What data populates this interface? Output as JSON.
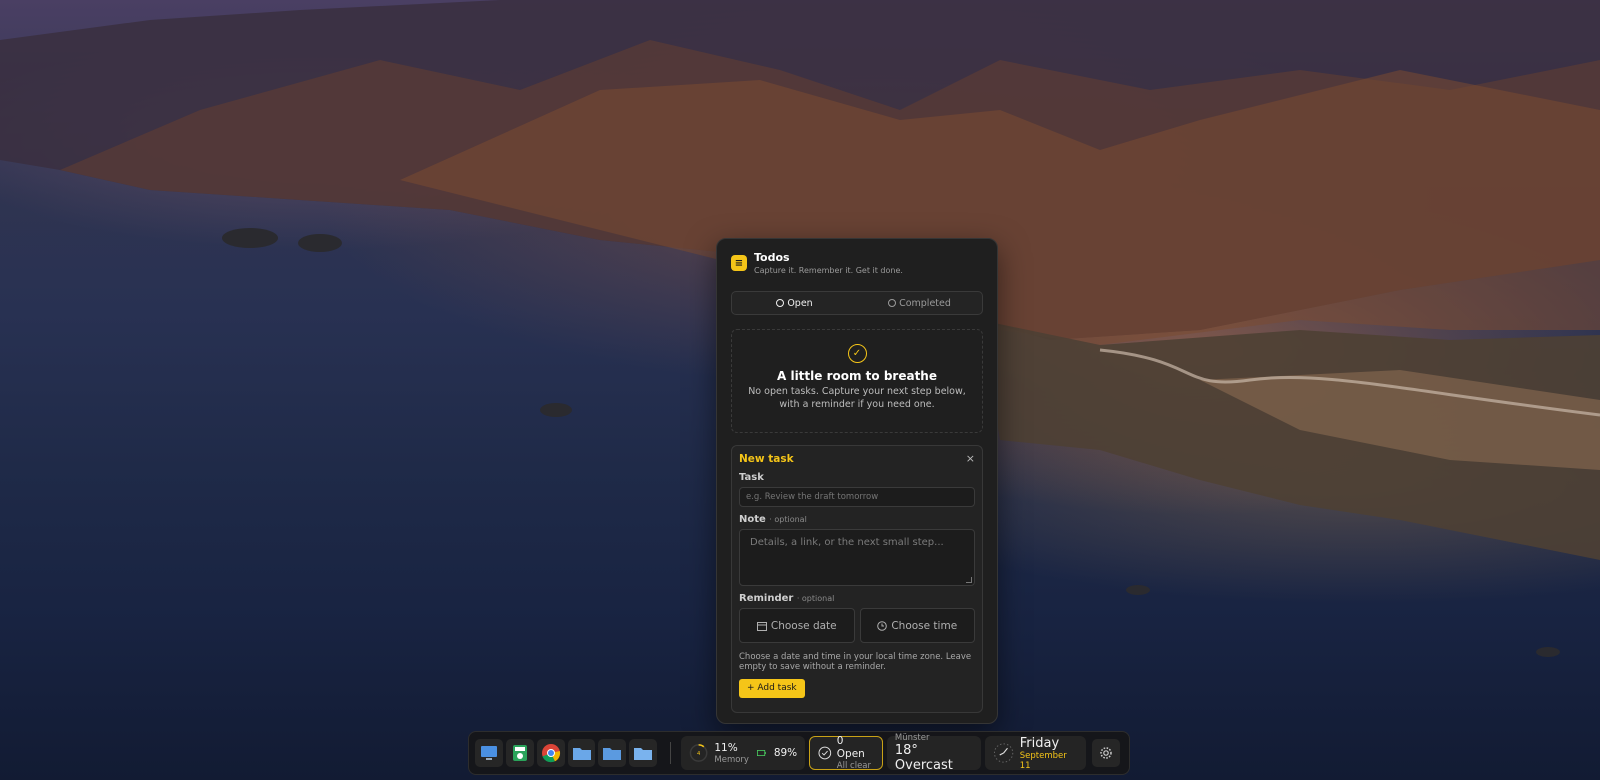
{
  "todos": {
    "title": "Todos",
    "subtitle": "Capture it. Remember it. Get it done.",
    "tabs": {
      "open": "Open",
      "completed": "Completed"
    },
    "empty": {
      "title": "A little room to breathe",
      "desc": "No open tasks. Capture your next step below, with a reminder if you need one."
    },
    "form": {
      "title": "New task",
      "close": "×",
      "task_label": "Task",
      "task_placeholder": "e.g. Review the draft tomorrow",
      "note_label": "Note",
      "optional": "· optional",
      "note_placeholder": "Details, a link, or the next small step...",
      "reminder_label": "Reminder",
      "date_btn": "Choose date",
      "time_btn": "Choose time",
      "hint": "Choose a date and time in your local time zone. Leave empty to save without a reminder.",
      "add_btn": "+ Add task"
    },
    "accent": "#f5c518"
  },
  "taskbar": {
    "memory_ring": "4",
    "memory_pct": "11%",
    "memory_label": "Memory",
    "battery_pct": "89%",
    "todos_open": "0 Open",
    "todos_status": "All clear",
    "weather_city": "Münster",
    "weather": "18° Overcast",
    "day": "Friday",
    "date": "September 11"
  }
}
